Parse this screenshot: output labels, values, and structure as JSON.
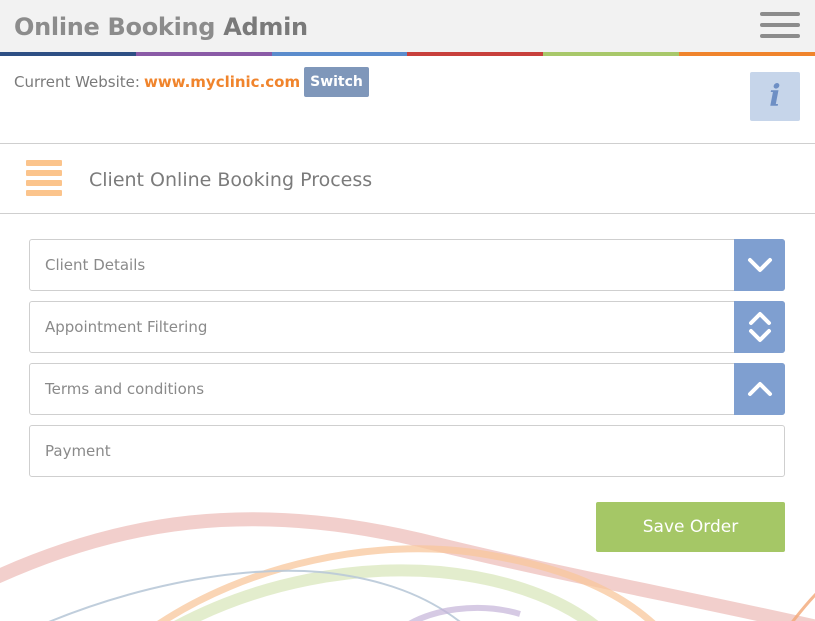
{
  "header": {
    "title_main": "Online Booking",
    "title_accent": "Admin",
    "menu_icon": "hamburger-menu-icon",
    "stripe_colors": [
      "#2e4f84",
      "#8a5aa6",
      "#5b8ccc",
      "#c8403c",
      "#a8c86a",
      "#f0842c"
    ]
  },
  "website": {
    "label": "Current Website:",
    "value": "www.myclinic.com",
    "switch_label": "Switch"
  },
  "info_button": {
    "glyph": "i",
    "icon": "info-icon"
  },
  "section": {
    "icon": "list-icon",
    "title": "Client Online Booking Process"
  },
  "accordion": [
    {
      "label": "Client Details",
      "icon": "chevron-down-icon"
    },
    {
      "label": "Appointment Filtering",
      "icon": "chevron-up-down-icon"
    },
    {
      "label": "Terms and conditions",
      "icon": "chevron-up-icon"
    },
    {
      "label": "Payment",
      "icon": ""
    }
  ],
  "actions": {
    "save_label": "Save Order"
  },
  "colors": {
    "accent_orange": "#f0842c",
    "button_blue": "#7f9fd0",
    "switch_blue": "#7f97ba",
    "save_green": "#a5c766",
    "text_gray": "#8a8a8a"
  }
}
